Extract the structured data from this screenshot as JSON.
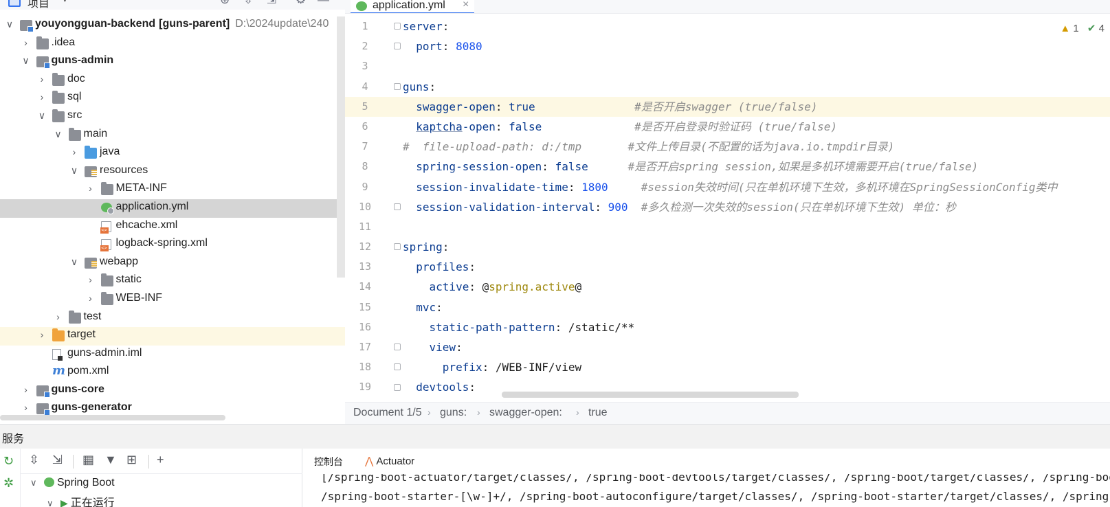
{
  "project_panel": {
    "title": "项目",
    "tree": [
      {
        "label": "youyongguan-backend",
        "suffix": "[guns-parent]",
        "hint": "D:\\2024update\\240",
        "bold": true,
        "depth": 0,
        "arrow": "open",
        "icon": "module-icon"
      },
      {
        "label": ".idea",
        "depth": 1,
        "arrow": "closed",
        "icon": "folder-icon"
      },
      {
        "label": "guns-admin",
        "depth": 1,
        "arrow": "open",
        "icon": "module-icon",
        "bold": true
      },
      {
        "label": "doc",
        "depth": 2,
        "arrow": "closed",
        "icon": "folder-icon"
      },
      {
        "label": "sql",
        "depth": 2,
        "arrow": "closed",
        "icon": "folder-icon"
      },
      {
        "label": "src",
        "depth": 2,
        "arrow": "open",
        "icon": "folder-icon"
      },
      {
        "label": "main",
        "depth": 3,
        "arrow": "open",
        "icon": "folder-icon"
      },
      {
        "label": "java",
        "depth": 4,
        "arrow": "closed",
        "icon": "source-folder-icon"
      },
      {
        "label": "resources",
        "depth": 4,
        "arrow": "open",
        "icon": "resources-folder-icon"
      },
      {
        "label": "META-INF",
        "depth": 5,
        "arrow": "closed",
        "icon": "folder-icon"
      },
      {
        "label": "application.yml",
        "depth": 5,
        "arrow": "none",
        "icon": "yml-file-icon",
        "selected": true
      },
      {
        "label": "ehcache.xml",
        "depth": 5,
        "arrow": "none",
        "icon": "xml-file-icon"
      },
      {
        "label": "logback-spring.xml",
        "depth": 5,
        "arrow": "none",
        "icon": "xml-file-icon"
      },
      {
        "label": "webapp",
        "depth": 4,
        "arrow": "open",
        "icon": "resources-folder-icon"
      },
      {
        "label": "static",
        "depth": 5,
        "arrow": "closed",
        "icon": "folder-icon"
      },
      {
        "label": "WEB-INF",
        "depth": 5,
        "arrow": "closed",
        "icon": "folder-icon"
      },
      {
        "label": "test",
        "depth": 3,
        "arrow": "closed",
        "icon": "folder-icon"
      },
      {
        "label": "target",
        "depth": 2,
        "arrow": "closed",
        "icon": "excluded-folder-icon",
        "highlight": true
      },
      {
        "label": "guns-admin.iml",
        "depth": 2,
        "arrow": "none",
        "icon": "iml-file-icon"
      },
      {
        "label": "pom.xml",
        "depth": 2,
        "arrow": "none",
        "icon": "maven-file-icon"
      },
      {
        "label": "guns-core",
        "depth": 1,
        "arrow": "closed",
        "icon": "module-icon",
        "bold": true
      },
      {
        "label": "guns-generator",
        "depth": 1,
        "arrow": "closed",
        "icon": "module-icon",
        "bold": true
      }
    ]
  },
  "editor": {
    "tab_label": "application.yml",
    "tab_close": "×",
    "inspection": {
      "warnings": "1",
      "ok": "4"
    },
    "line_numbers": [
      "1",
      "2",
      "3",
      "4",
      "5",
      "6",
      "7",
      "8",
      "9",
      "10",
      "11",
      "12",
      "13",
      "14",
      "15",
      "16",
      "17",
      "18",
      "19"
    ],
    "lines": [
      [
        {
          "t": "server",
          "c": "k"
        },
        {
          "t": ":",
          "c": "plain"
        }
      ],
      [
        {
          "t": "  port",
          "c": "k"
        },
        {
          "t": ": ",
          "c": "plain"
        },
        {
          "t": "8080",
          "c": "num"
        }
      ],
      [],
      [
        {
          "t": "guns",
          "c": "k"
        },
        {
          "t": ":",
          "c": "plain"
        }
      ],
      [
        {
          "t": "  swagger-open",
          "c": "k"
        },
        {
          "t": ": ",
          "c": "plain"
        },
        {
          "t": "true",
          "c": "bool"
        },
        {
          "t": "               ",
          "c": "plain"
        },
        {
          "t": "#是否开启swagger (true/false)",
          "c": "cmt"
        }
      ],
      [
        {
          "t": "  ",
          "c": "plain"
        },
        {
          "t": "kaptcha",
          "c": "k-u"
        },
        {
          "t": "-open",
          "c": "k"
        },
        {
          "t": ": ",
          "c": "plain"
        },
        {
          "t": "false",
          "c": "bool"
        },
        {
          "t": "              ",
          "c": "plain"
        },
        {
          "t": "#是否开启登录时验证码 (true/false)",
          "c": "cmt"
        }
      ],
      [
        {
          "t": "#  file-upload-path: d:/tmp       #文件上传目录(不配置的话为java.io.tmpdir目录)",
          "c": "cmt"
        }
      ],
      [
        {
          "t": "  spring-session-open",
          "c": "k"
        },
        {
          "t": ": ",
          "c": "plain"
        },
        {
          "t": "false",
          "c": "bool"
        },
        {
          "t": "      ",
          "c": "plain"
        },
        {
          "t": "#是否开启spring session,如果是多机环境需要开启(true/false)",
          "c": "cmt"
        }
      ],
      [
        {
          "t": "  session-invalidate-time",
          "c": "k"
        },
        {
          "t": ": ",
          "c": "plain"
        },
        {
          "t": "1800",
          "c": "num"
        },
        {
          "t": "     ",
          "c": "plain"
        },
        {
          "t": "#session失效时间(只在单机环境下生效，多机环境在SpringSessionConfig类中",
          "c": "cmt"
        }
      ],
      [
        {
          "t": "  session-validation-interval",
          "c": "k"
        },
        {
          "t": ": ",
          "c": "plain"
        },
        {
          "t": "900",
          "c": "num"
        },
        {
          "t": "  ",
          "c": "plain"
        },
        {
          "t": "#多久检测一次失效的session(只在单机环境下生效) 单位：秒",
          "c": "cmt"
        }
      ],
      [],
      [
        {
          "t": "spring",
          "c": "k"
        },
        {
          "t": ":",
          "c": "plain"
        }
      ],
      [
        {
          "t": "  profiles",
          "c": "k"
        },
        {
          "t": ":",
          "c": "plain"
        }
      ],
      [
        {
          "t": "    active",
          "c": "k"
        },
        {
          "t": ": @",
          "c": "plain"
        },
        {
          "t": "spring.active",
          "c": "prop"
        },
        {
          "t": "@",
          "c": "plain"
        }
      ],
      [
        {
          "t": "  mvc",
          "c": "k"
        },
        {
          "t": ":",
          "c": "plain"
        }
      ],
      [
        {
          "t": "    static-path-pattern",
          "c": "k"
        },
        {
          "t": ": /static/**",
          "c": "plain"
        }
      ],
      [
        {
          "t": "    view",
          "c": "k"
        },
        {
          "t": ":",
          "c": "plain"
        }
      ],
      [
        {
          "t": "      prefix",
          "c": "k"
        },
        {
          "t": ": /WEB-INF/view",
          "c": "plain"
        }
      ],
      [
        {
          "t": "  devtools",
          "c": "k"
        },
        {
          "t": ":",
          "c": "plain"
        }
      ]
    ],
    "breadcrumb": [
      "Document 1/5",
      "guns:",
      "swagger-open:",
      "true"
    ]
  },
  "services": {
    "title": "服务",
    "tree": {
      "root_label": "Spring Boot",
      "child_label": "正在运行"
    },
    "tabs": {
      "console": "控制台",
      "actuator": "Actuator"
    },
    "console_lines": [
      "[/spring-boot-actuator/target/classes/, /spring-boot-devtools/target/classes/, /spring-boot/target/classes/, /spring-boot-starter/target/classes/",
      "/spring-boot-starter-[\\w-]+/, /spring-boot-autoconfigure/target/classes/, /spring-boot-starter/target/classes/, /spring-boot-actuator/target/classes/"
    ]
  },
  "colors": {
    "accent": "#3574f0",
    "keyword": "#0c3d91",
    "number": "#1750eb",
    "comment": "#8c8c8c",
    "selection": "#d5d5d5",
    "caret_line": "#fdf8e3"
  }
}
